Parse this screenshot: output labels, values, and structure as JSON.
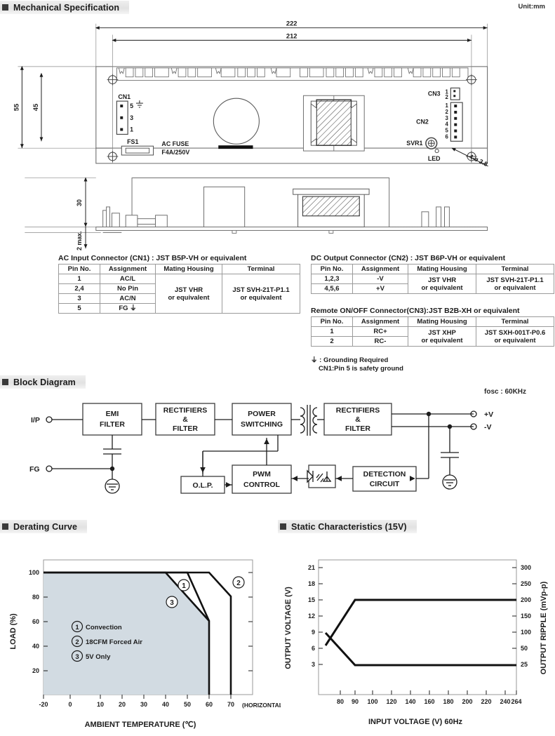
{
  "sections": {
    "mechanical": "Mechanical Specification",
    "block": "Block Diagram",
    "derating": "Derating Curve",
    "static": "Static Characteristics (15V)"
  },
  "unit_note": "Unit:mm",
  "fosc": "fosc : 60KHz",
  "mechanical": {
    "dims": {
      "overall_length": "222",
      "inner_length": "212",
      "height_total": "55",
      "hole_span": "45",
      "side_height": "30",
      "pcb_thickness": "2 max."
    },
    "labels": {
      "cn1": "CN1",
      "cn1_pin5": "5",
      "cn1_pin3": "3",
      "cn1_pin1": "1",
      "cn2": "CN2",
      "cn3": "CN3",
      "fs1": "FS1",
      "fuse1": "AC FUSE",
      "fuse2": "F4A/250V",
      "svr1": "SVR1",
      "led": "LED",
      "hole_spec": "4-ø 3.8",
      "cn2_pins": [
        "1",
        "2",
        "3",
        "4",
        "5",
        "6"
      ],
      "cn3_pins": [
        "1",
        "2"
      ]
    }
  },
  "connectors": {
    "cn1": {
      "title": "AC Input Connector (CN1) : JST B5P-VH or equivalent",
      "headers": [
        "Pin No.",
        "Assignment",
        "Mating Housing",
        "Terminal"
      ],
      "rows": [
        {
          "pin": "1",
          "assign": "AC/L"
        },
        {
          "pin": "2,4",
          "assign": "No Pin"
        },
        {
          "pin": "3",
          "assign": "AC/N"
        },
        {
          "pin": "5",
          "assign": "FG ⏚"
        }
      ],
      "housing": "JST VHR\nor equivalent",
      "housing_l1": "JST VHR",
      "housing_l2": "or equivalent",
      "terminal_l1": "JST SVH-21T-P1.1",
      "terminal_l2": "or equivalent"
    },
    "cn2": {
      "title": "DC Output Connector (CN2) : JST B6P-VH or equivalent",
      "headers": [
        "Pin No.",
        "Assignment",
        "Mating Housing",
        "Terminal"
      ],
      "rows": [
        {
          "pin": "1,2,3",
          "assign": "-V"
        },
        {
          "pin": "4,5,6",
          "assign": "+V"
        }
      ],
      "housing_l1": "JST VHR",
      "housing_l2": "or equivalent",
      "terminal_l1": "JST SVH-21T-P1.1",
      "terminal_l2": "or equivalent"
    },
    "cn3": {
      "title": "Remote ON/OFF Connector(CN3):JST B2B-XH or equivalent",
      "headers": [
        "Pin No.",
        "Assignment",
        "Mating Housing",
        "Terminal"
      ],
      "rows": [
        {
          "pin": "1",
          "assign": "RC+"
        },
        {
          "pin": "2",
          "assign": "RC-"
        }
      ],
      "housing_l1": "JST XHP",
      "housing_l2": "or equivalent",
      "terminal_l1": "JST SXH-001T-P0.6",
      "terminal_l2": "or equivalent"
    },
    "ground_note_1": "⏚ : Grounding Required",
    "ground_note_2": "CN1:Pin 5 is safety ground"
  },
  "block_diagram": {
    "input_label": "I/P",
    "fg_label": "FG",
    "boxes": {
      "emi": "EMI\nFILTER",
      "emi_l1": "EMI",
      "emi_l2": "FILTER",
      "rect1_l1": "RECTIFIERS",
      "rect1_l2": "&",
      "rect1_l3": "FILTER",
      "power_l1": "POWER",
      "power_l2": "SWITCHING",
      "rect2_l1": "RECTIFIERS",
      "rect2_l2": "&",
      "rect2_l3": "FILTER",
      "olp": "O.L.P.",
      "pwm_l1": "PWM",
      "pwm_l2": "CONTROL",
      "detect_l1": "DETECTION",
      "detect_l2": "CIRCUIT"
    },
    "outputs": {
      "pos": "+V",
      "neg": "-V"
    }
  },
  "chart_data": [
    {
      "type": "line",
      "name": "derating-curve",
      "title": "Derating Curve",
      "xlabel": "AMBIENT TEMPERATURE (℃)",
      "ylabel": "LOAD (%)",
      "xlim": [
        -20,
        75
      ],
      "ylim": [
        0,
        110
      ],
      "xticks": [
        -20,
        0,
        10,
        20,
        30,
        40,
        50,
        60,
        70
      ],
      "xticklabels": [
        "-20",
        "0",
        "10",
        "20",
        "30",
        "40",
        "50",
        "60",
        "70"
      ],
      "yticks": [
        20,
        40,
        60,
        80,
        100
      ],
      "yticklabels": [
        "20",
        "40",
        "60",
        "80",
        "100"
      ],
      "x_extra_label": "(HORIZONTAL)",
      "grid": false,
      "legend_position": "inside-left",
      "legend": [
        {
          "marker": "①",
          "label": "Convection"
        },
        {
          "marker": "②",
          "label": "18CFM Forced Air"
        },
        {
          "marker": "③",
          "label": "5V Only"
        }
      ],
      "series": [
        {
          "name": "Convection",
          "marker": "①",
          "points": [
            [
              -20,
              100
            ],
            [
              50,
              100
            ],
            [
              60,
              60
            ],
            [
              60,
              0
            ]
          ]
        },
        {
          "name": "18CFM Forced Air",
          "marker": "②",
          "points": [
            [
              -20,
              100
            ],
            [
              60,
              100
            ],
            [
              70,
              80
            ],
            [
              70,
              0
            ]
          ]
        },
        {
          "name": "5V Only",
          "marker": "③",
          "points": [
            [
              -20,
              100
            ],
            [
              40,
              100
            ],
            [
              60,
              60
            ],
            [
              60,
              0
            ]
          ]
        }
      ],
      "shaded_region": "5V Only curve area filled light blue-grey",
      "shade_color": "#d2dbe2"
    },
    {
      "type": "line",
      "name": "static-characteristics",
      "title": "Static Characteristics (15V)",
      "xlabel": "INPUT VOLTAGE (V) 60Hz",
      "ylabel": "OUTPUT VOLTAGE (V)",
      "ylabel_right": "OUTPUT RIPPLE (mVp-p)",
      "xlim": [
        70,
        270
      ],
      "ylim": [
        0,
        22
      ],
      "ylim_right": [
        0,
        315
      ],
      "xticks": [
        80,
        90,
        100,
        120,
        140,
        160,
        180,
        200,
        220,
        240,
        264
      ],
      "xticklabels": [
        "80",
        "90",
        "100",
        "120",
        "140",
        "160",
        "180",
        "200",
        "220",
        "240",
        "264"
      ],
      "yticks": [
        3,
        6,
        9,
        12,
        15,
        18,
        21
      ],
      "yticklabels": [
        "3",
        "6",
        "9",
        "12",
        "15",
        "18",
        "21"
      ],
      "yticks_right": [
        25,
        50,
        100,
        150,
        200,
        250,
        300
      ],
      "yticklabels_right": [
        "25",
        "50",
        "100",
        "150",
        "200",
        "250",
        "300"
      ],
      "grid": false,
      "series": [
        {
          "name": "Output Voltage",
          "axis": "left",
          "points": [
            [
              74,
              9.2
            ],
            [
              90,
              15
            ],
            [
              264,
              15
            ]
          ]
        },
        {
          "name": "Output Ripple",
          "axis": "left_scaled",
          "points": [
            [
              74,
              11.2
            ],
            [
              90,
              6
            ],
            [
              264,
              6
            ]
          ]
        }
      ]
    }
  ],
  "colors": {
    "ink": "#231f20",
    "line": "#1c1c1c",
    "table_border": "#9b9b9b",
    "shade": "#d2dbe2",
    "header_bg": "#e6e6e6"
  }
}
